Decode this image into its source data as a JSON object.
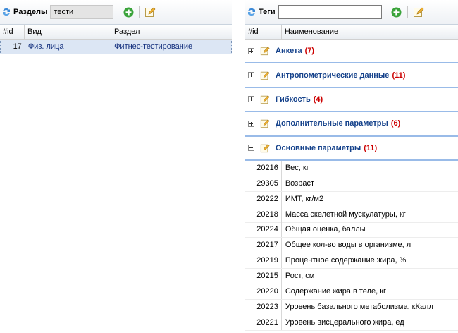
{
  "sections_panel": {
    "title": "Разделы",
    "search_value": "тести",
    "icons": {
      "refresh": "refresh-icon",
      "add": "add-icon",
      "edit": "edit-icon"
    },
    "columns": [
      "#id",
      "Вид",
      "Раздел"
    ],
    "rows": [
      {
        "id": "17",
        "vid": "Физ. лица",
        "razdel": "Фитнес-тестирование"
      }
    ]
  },
  "tags_panel": {
    "title": "Теги",
    "search_value": "",
    "columns": [
      "#id",
      "Наименование"
    ],
    "groups": [
      {
        "name": "Анкета",
        "count": "(7)",
        "expanded": false
      },
      {
        "name": "Антропометрические данные",
        "count": "(11)",
        "expanded": false
      },
      {
        "name": "Гибкость",
        "count": "(4)",
        "expanded": false
      },
      {
        "name": "Дополнительные параметры",
        "count": "(6)",
        "expanded": false
      },
      {
        "name": "Основные параметры",
        "count": "(11)",
        "expanded": true
      }
    ],
    "rows": [
      {
        "id": "20216",
        "name": "Вес, кг"
      },
      {
        "id": "29305",
        "name": "Возраст"
      },
      {
        "id": "20222",
        "name": "ИМТ, кг/м2"
      },
      {
        "id": "20218",
        "name": "Масса скелетной мускулатуры, кг"
      },
      {
        "id": "20224",
        "name": "Общая оценка, баллы"
      },
      {
        "id": "20217",
        "name": "Общее кол-во воды в организме, л"
      },
      {
        "id": "20219",
        "name": "Процентное содержание жира, %"
      },
      {
        "id": "20215",
        "name": "Рост, см"
      },
      {
        "id": "20220",
        "name": "Содержание жира в теле, кг"
      },
      {
        "id": "20223",
        "name": "Уровень базального метаболизма, кКалл"
      },
      {
        "id": "20221",
        "name": "Уровень висцерального жира, ед"
      }
    ]
  },
  "colors": {
    "group_name": "#15428b",
    "group_count": "#cc0000",
    "selected_row": "#dce6f4",
    "link": "#15317e"
  }
}
